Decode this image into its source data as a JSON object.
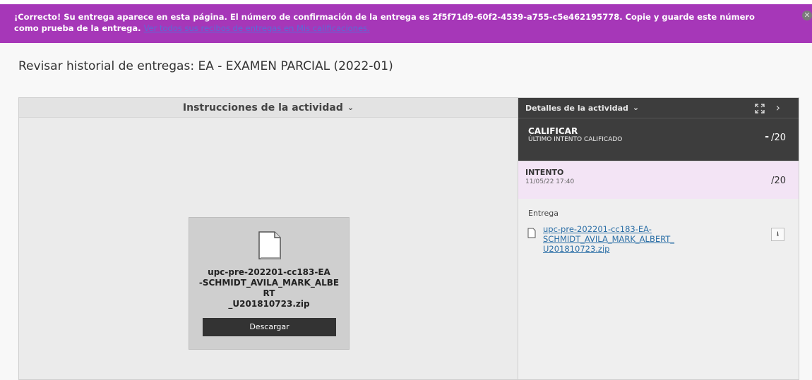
{
  "banner": {
    "message": "¡Correcto! Su entrega aparece en esta página. El número de confirmación de la entrega es 2f5f71d9-60f2-4539-a755-c5e462195778. Copie y guarde este número como prueba de la entrega.",
    "link_text": "Ver todos sus recibos de entregas en Mis calificaciones."
  },
  "page": {
    "title": "Revisar historial de entregas: EA - EXAMEN PARCIAL (2022-01)"
  },
  "left": {
    "header": "Instrucciones de la actividad",
    "file_name": "upc-pre-202201-cc183-EA-SCHMIDT_AVILA_MARK_ALBERT_U201810723.zip",
    "download_label": "Descargar"
  },
  "right": {
    "header": "Detalles de la actividad",
    "grade_title": "CALIFICAR",
    "grade_subtitle": "ÚLTIMO INTENTO CALIFICADO",
    "grade_dash": "-",
    "grade_value": "/20",
    "attempt_title": "INTENTO",
    "attempt_date": "11/05/22 17:40",
    "attempt_value": "/20",
    "entrega_label": "Entrega",
    "entrega_file": "upc-pre-202201-cc183-EA-SCHMIDT_AVILA_MARK_ALBERT_U201810723.zip"
  },
  "colors": {
    "banner_bg": "#a637b8",
    "dark_panel": "#3d3d3d",
    "attempt_bg": "#f3e4f5",
    "link": "#2a6ea6"
  }
}
